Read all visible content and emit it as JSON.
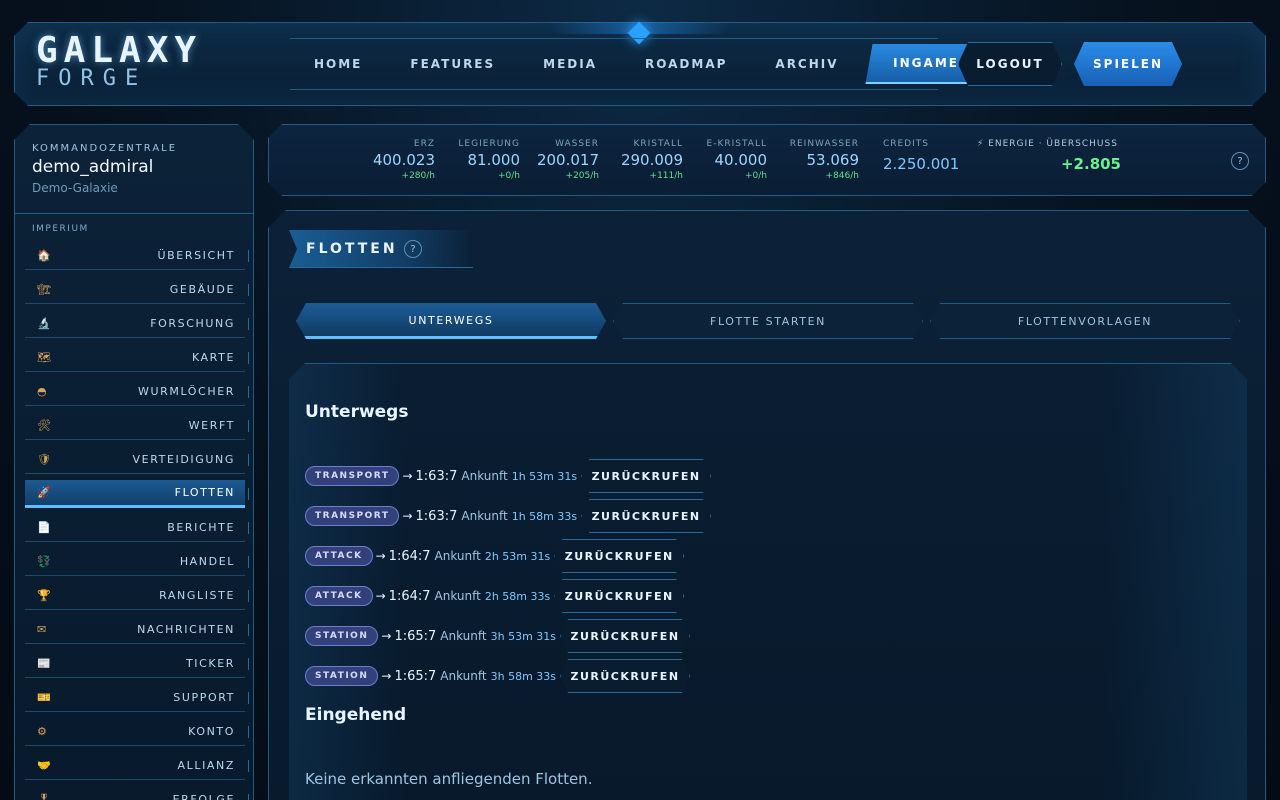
{
  "header": {
    "logo_line1": "GALAXY",
    "logo_line2": "FORGE",
    "nav": [
      "HOME",
      "FEATURES",
      "MEDIA",
      "ROADMAP",
      "ARCHIV"
    ],
    "nav_active": "INGAME",
    "logout_label": "LOGOUT",
    "play_label": "SPIELEN"
  },
  "sidebar": {
    "section_label": "KOMMANDOZENTRALE",
    "username": "demo_admiral",
    "galaxy": "Demo-Galaxie",
    "group_label": "IMPERIUM",
    "active": "FLOTTEN",
    "items": [
      {
        "icon": "🏠",
        "label": "ÜBERSICHT"
      },
      {
        "icon": "🏗",
        "label": "GEBÄUDE"
      },
      {
        "icon": "🔬",
        "label": "FORSCHUNG"
      },
      {
        "icon": "🗺",
        "label": "KARTE"
      },
      {
        "icon": "◓",
        "label": "WURMLÖCHER"
      },
      {
        "icon": "🛠",
        "label": "WERFT"
      },
      {
        "icon": "🛡",
        "label": "VERTEIDIGUNG"
      },
      {
        "icon": "🚀",
        "label": "FLOTTEN"
      },
      {
        "icon": "📄",
        "label": "BERICHTE"
      },
      {
        "icon": "💱",
        "label": "HANDEL"
      },
      {
        "icon": "🏆",
        "label": "RANGLISTE"
      },
      {
        "icon": "✉",
        "label": "NACHRICHTEN"
      },
      {
        "icon": "📰",
        "label": "TICKER"
      },
      {
        "icon": "🎫",
        "label": "SUPPORT"
      },
      {
        "icon": "⚙",
        "label": "KONTO"
      },
      {
        "icon": "🤝",
        "label": "ALLIANZ"
      },
      {
        "icon": "🎖",
        "label": "ERFOLGE"
      }
    ]
  },
  "resources": [
    {
      "name": "ERZ",
      "value": "400.023",
      "rate": "+280/h"
    },
    {
      "name": "LEGIERUNG",
      "value": "81.000",
      "rate": "+0/h"
    },
    {
      "name": "WASSER",
      "value": "200.017",
      "rate": "+205/h"
    },
    {
      "name": "KRISTALL",
      "value": "290.009",
      "rate": "+111/h"
    },
    {
      "name": "E-KRISTALL",
      "value": "40.000",
      "rate": "+0/h"
    },
    {
      "name": "REINWASSER",
      "value": "53.069",
      "rate": "+846/h"
    }
  ],
  "credits": {
    "name": "CREDITS",
    "value": "2.250.001"
  },
  "energy": {
    "name": "⚡ ENERGIE · ÜBERSCHUSS",
    "value": "+2.805"
  },
  "help_symbol": "?",
  "main": {
    "title": "FLOTTEN",
    "tabs": [
      "UNTERWEGS",
      "FLOTTE STARTEN",
      "FLOTTENVORLAGEN"
    ],
    "active_tab": "UNTERWEGS",
    "section_outgoing": "Unterwegs",
    "arrival_label": "Ankunft",
    "recall_label": "ZURÜCKRUFEN",
    "fleets": [
      {
        "mission": "TRANSPORT",
        "target": "1:63:7",
        "eta": "1h 53m 31s"
      },
      {
        "mission": "TRANSPORT",
        "target": "1:63:7",
        "eta": "1h 58m 33s"
      },
      {
        "mission": "ATTACK",
        "target": "1:64:7",
        "eta": "2h 53m 31s"
      },
      {
        "mission": "ATTACK",
        "target": "1:64:7",
        "eta": "2h 58m 33s"
      },
      {
        "mission": "STATION",
        "target": "1:65:7",
        "eta": "3h 53m 31s"
      },
      {
        "mission": "STATION",
        "target": "1:65:7",
        "eta": "3h 58m 33s"
      }
    ],
    "section_incoming": "Eingehend",
    "incoming_empty": "Keine erkannten anfliegenden Flotten."
  }
}
